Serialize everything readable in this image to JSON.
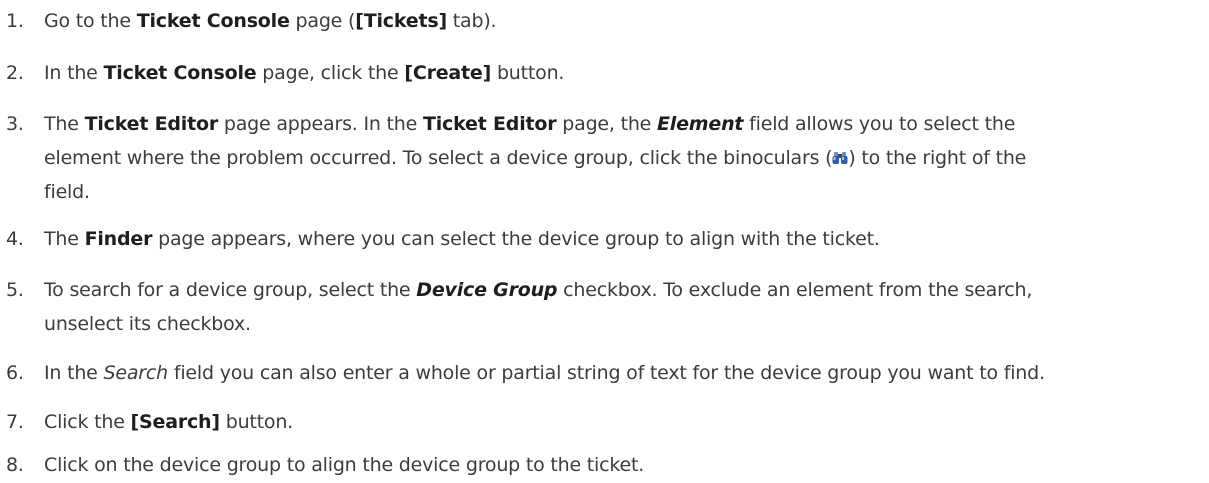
{
  "steps": [
    {
      "number": "1.",
      "segments": [
        {
          "t": "Go to the "
        },
        {
          "t": "Ticket Console",
          "s": "b"
        },
        {
          "t": " page ("
        },
        {
          "t": "[Tickets]",
          "s": "b"
        },
        {
          "t": " tab)."
        }
      ]
    },
    {
      "number": "2.",
      "segments": [
        {
          "t": "In the "
        },
        {
          "t": "Ticket Console",
          "s": "b"
        },
        {
          "t": " page, click the "
        },
        {
          "t": "[Create]",
          "s": "b"
        },
        {
          "t": " button."
        }
      ]
    },
    {
      "number": "3.",
      "segments": [
        {
          "t": "The "
        },
        {
          "t": "Ticket Editor",
          "s": "b"
        },
        {
          "t": " page appears. In the "
        },
        {
          "t": "Ticket Editor",
          "s": "b"
        },
        {
          "t": " page, the "
        },
        {
          "t": "Element",
          "s": "bi"
        },
        {
          "t": " field allows you to select the"
        },
        {
          "br": true
        },
        {
          "t": "element where the problem occurred. To select a device group, click the binoculars ("
        },
        {
          "icon": "binoculars-icon"
        },
        {
          "t": ") to the right of the"
        },
        {
          "br": true
        },
        {
          "t": "field."
        }
      ]
    },
    {
      "number": "4.",
      "segments": [
        {
          "t": "The "
        },
        {
          "t": "Finder",
          "s": "b"
        },
        {
          "t": " page appears, where you can select the device group to align with the ticket."
        }
      ]
    },
    {
      "number": "5.",
      "segments": [
        {
          "t": "To search for a device group, select the "
        },
        {
          "t": "Device Group",
          "s": "bi"
        },
        {
          "t": " checkbox. To exclude an element from the search,"
        },
        {
          "br": true
        },
        {
          "t": "unselect its checkbox."
        }
      ]
    },
    {
      "number": "6.",
      "segments": [
        {
          "t": "In the "
        },
        {
          "t": "Search",
          "s": "it"
        },
        {
          "t": " field you can also enter a whole or partial string of text for the device group you want to find."
        }
      ]
    },
    {
      "number": "7.",
      "segments": [
        {
          "t": "Click the "
        },
        {
          "t": "[Search]",
          "s": "b"
        },
        {
          "t": " button."
        }
      ]
    },
    {
      "number": "8.",
      "segments": [
        {
          "t": "Click on the device group to align the device group to the ticket."
        }
      ]
    }
  ],
  "colors": {
    "text": "#3c3c3c",
    "emphasis": "#1e1e1e",
    "icon_blue": "#2f5fa8"
  }
}
